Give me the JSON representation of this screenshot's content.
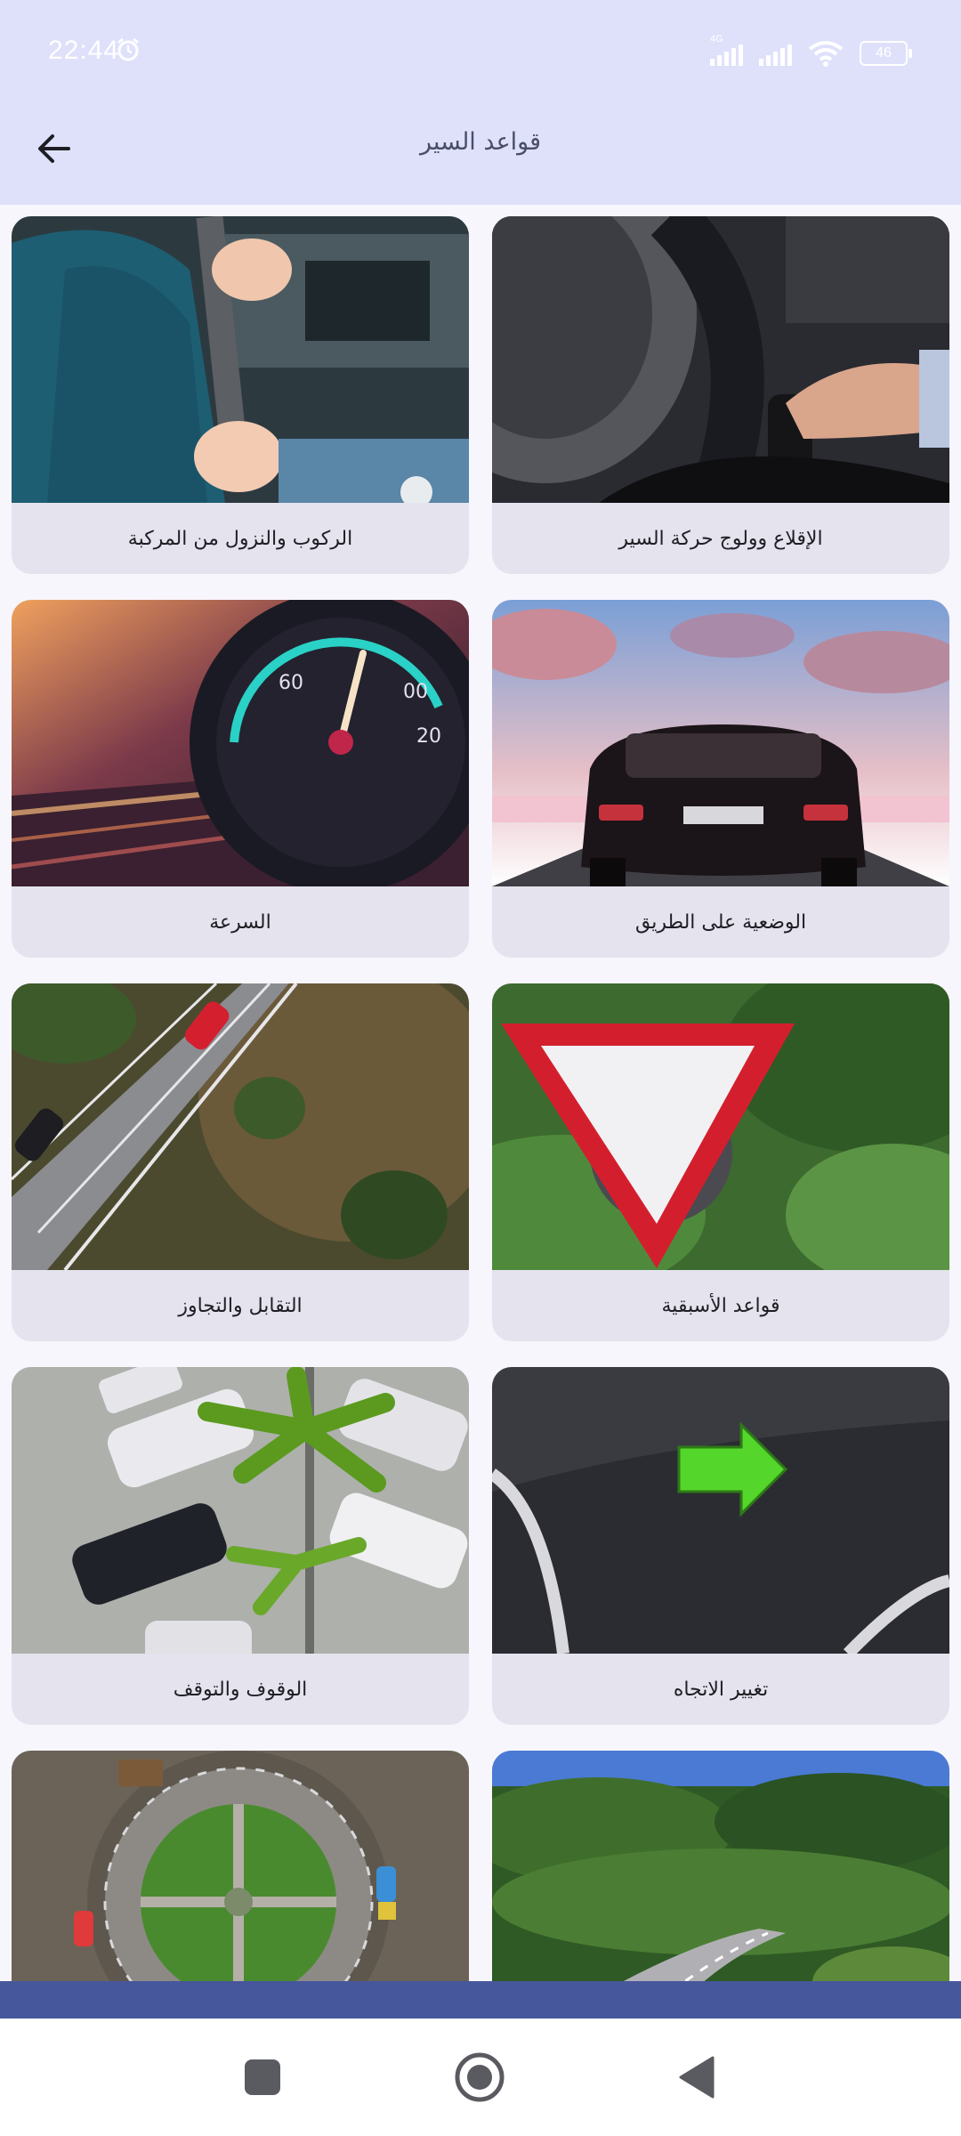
{
  "status_bar": {
    "time": "22:44",
    "network_label": "4G",
    "battery_level": "46",
    "icons": [
      "alarm-icon",
      "signal-icon",
      "signal-icon",
      "wifi-icon",
      "battery-icon"
    ]
  },
  "app_bar": {
    "title": "قواعد السير",
    "back_icon": "arrow-left-icon"
  },
  "cards": [
    {
      "label": "الإقلاع وولوج حركة السير",
      "image": "hand on gear shift and steering wheel"
    },
    {
      "label": "الركوب والنزول من المركبة",
      "image": "driver fastening seat belt"
    },
    {
      "label": "الوضعية على الطريق",
      "image": "rear of black car on road"
    },
    {
      "label": "السرعة",
      "image": "speedometer with motion blur"
    },
    {
      "label": "قواعد الأسبقية",
      "image": "yield triangle sign"
    },
    {
      "label": "التقابل والتجاوز",
      "image": "aerial view of highway with cars"
    },
    {
      "label": "تغيير الاتجاه",
      "image": "green turn signal arrow"
    },
    {
      "label": "الوقوف والتوقف",
      "image": "aerial view of parked cars"
    },
    {
      "label": "",
      "image": "winding road through forest"
    },
    {
      "label": "",
      "image": "aerial view of roundabout"
    }
  ],
  "colors": {
    "header_bg": "#dfe1fb",
    "card_bg": "#e4e3ee",
    "bottom_strip": "#46579c",
    "title_text": "#4a4f68"
  },
  "nav_bar": {
    "buttons": [
      "square-icon",
      "circle-home-icon",
      "triangle-back-icon"
    ]
  }
}
